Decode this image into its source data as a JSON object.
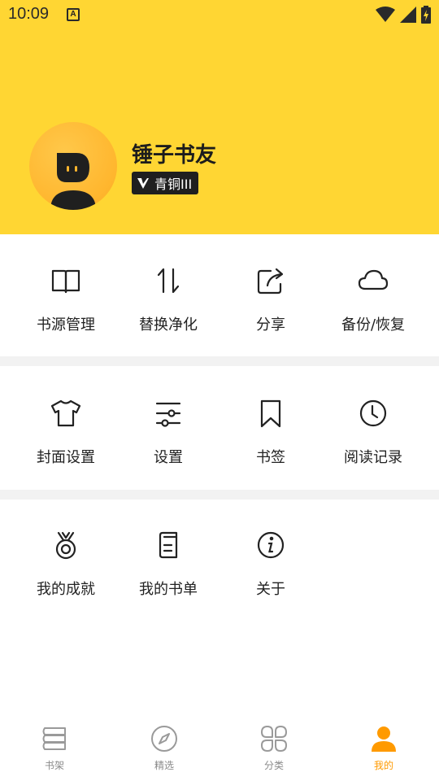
{
  "status_bar": {
    "time": "10:09",
    "notification_icon": "a-letter-icon",
    "icons": [
      "wifi-icon",
      "signal-icon",
      "battery-charging-icon"
    ]
  },
  "profile": {
    "username": "锤子书友",
    "level_badge": "青铜III",
    "accent_color": "#FFD633"
  },
  "menu_sections": [
    {
      "items": [
        {
          "label": "书源管理",
          "icon": "open-book-icon"
        },
        {
          "label": "替换净化",
          "icon": "swap-arrows-icon"
        },
        {
          "label": "分享",
          "icon": "share-icon"
        },
        {
          "label": "备份/恢复",
          "icon": "cloud-icon"
        }
      ]
    },
    {
      "items": [
        {
          "label": "封面设置",
          "icon": "tshirt-icon"
        },
        {
          "label": "设置",
          "icon": "sliders-icon"
        },
        {
          "label": "书签",
          "icon": "bookmark-icon"
        },
        {
          "label": "阅读记录",
          "icon": "clock-icon"
        }
      ]
    },
    {
      "items": [
        {
          "label": "我的成就",
          "icon": "medal-icon"
        },
        {
          "label": "我的书单",
          "icon": "booklist-icon"
        },
        {
          "label": "关于",
          "icon": "info-icon"
        }
      ]
    }
  ],
  "tab_bar": {
    "active_color": "#FF9A00",
    "tabs": [
      {
        "label": "书架",
        "icon": "bookshelf-icon",
        "active": false
      },
      {
        "label": "精选",
        "icon": "compass-icon",
        "active": false
      },
      {
        "label": "分类",
        "icon": "categories-icon",
        "active": false
      },
      {
        "label": "我的",
        "icon": "person-icon",
        "active": true
      }
    ]
  }
}
